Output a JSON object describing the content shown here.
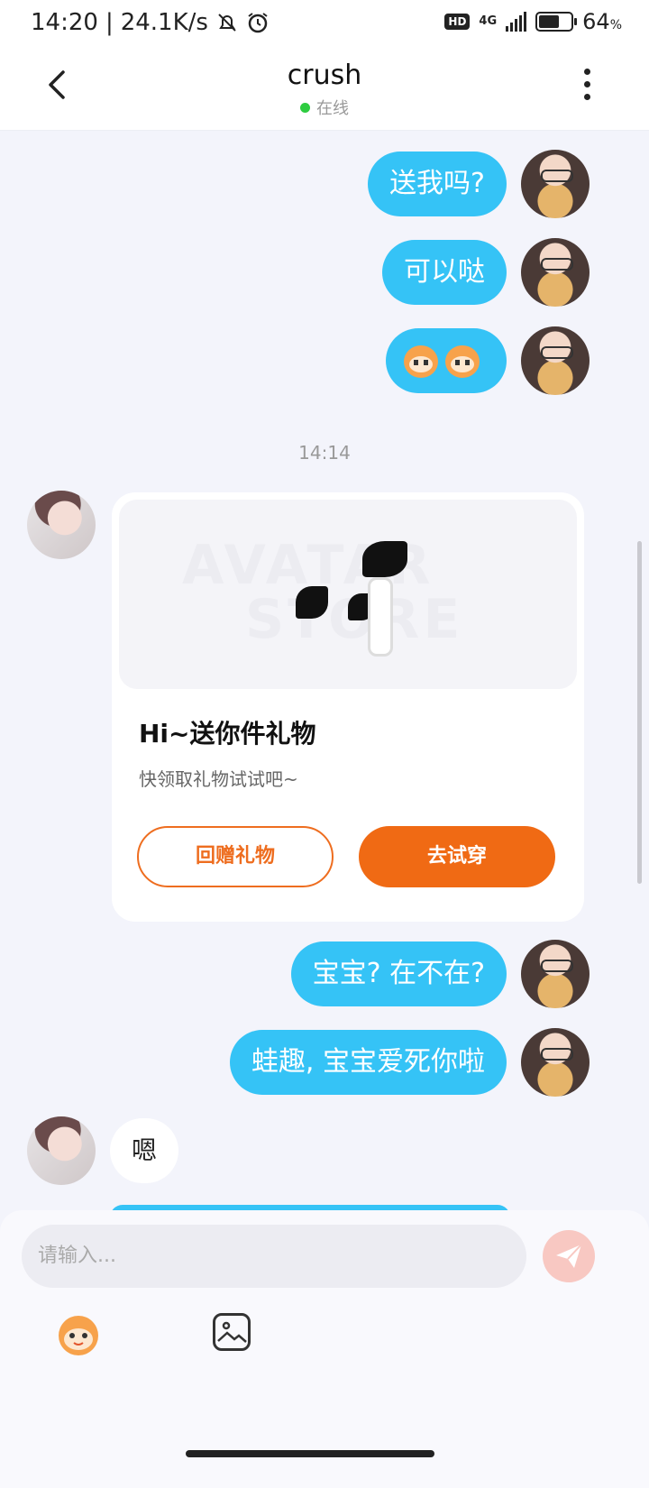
{
  "status_bar": {
    "time": "14:20",
    "net_speed": "24.1K/s",
    "hd": "HD",
    "signal": "4G",
    "battery_level": 0.64,
    "battery_text": "64",
    "battery_unit": "%"
  },
  "header": {
    "title": "crush",
    "status": "在线"
  },
  "messages": {
    "m1": "送我吗?",
    "m2": "可以哒",
    "timestamp": "14:14",
    "m4": "宝宝? 在不在?",
    "m5": "蛙趣, 宝宝爱死你啦",
    "m6": "嗯"
  },
  "gift_card": {
    "watermark_top": "AVATAR",
    "watermark_bottom": "STORE",
    "title": "Hi~送你件礼物",
    "subtitle": "快领取礼物试试吧~",
    "return_gift_label": "回赠礼物",
    "try_on_label": "去试穿"
  },
  "input": {
    "placeholder": "请输入..."
  },
  "colors": {
    "accent_blue": "#35c3f6",
    "accent_orange": "#f06a14"
  }
}
